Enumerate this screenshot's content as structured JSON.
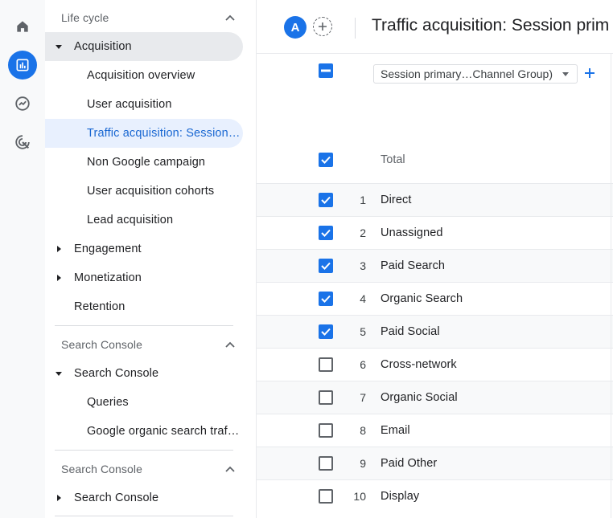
{
  "rail": {
    "items": [
      {
        "icon": "home-icon",
        "active": false
      },
      {
        "icon": "reports-icon",
        "active": true
      },
      {
        "icon": "explore-icon",
        "active": false
      },
      {
        "icon": "advertising-icon",
        "active": false
      }
    ]
  },
  "nav": {
    "sections": [
      {
        "title": "Life cycle",
        "items": [
          {
            "label": "Acquisition",
            "level": 1,
            "caret": "down",
            "expanded": true
          },
          {
            "label": "Acquisition overview",
            "level": 2
          },
          {
            "label": "User acquisition",
            "level": 2
          },
          {
            "label": "Traffic acquisition: Session…",
            "level": 2,
            "selected": true
          },
          {
            "label": "Non Google campaign",
            "level": 2
          },
          {
            "label": "User acquisition cohorts",
            "level": 2
          },
          {
            "label": "Lead acquisition",
            "level": 2
          },
          {
            "label": "Engagement",
            "level": 1,
            "caret": "right"
          },
          {
            "label": "Monetization",
            "level": 1,
            "caret": "right"
          },
          {
            "label": "Retention",
            "level": 1
          }
        ]
      },
      {
        "title": "Search Console",
        "items": [
          {
            "label": "Search Console",
            "level": 1,
            "caret": "down"
          },
          {
            "label": "Queries",
            "level": 2
          },
          {
            "label": "Google organic search traf…",
            "level": 2
          }
        ]
      },
      {
        "title": "Search Console",
        "items": [
          {
            "label": "Search Console",
            "level": 1,
            "caret": "right"
          }
        ]
      }
    ]
  },
  "header": {
    "avatar_letter": "A",
    "title": "Traffic acquisition: Session prim"
  },
  "table": {
    "dimension_select": "Session primary…Channel Group)",
    "total_label": "Total",
    "rows": [
      {
        "num": "1",
        "label": "Direct",
        "checked": true
      },
      {
        "num": "2",
        "label": "Unassigned",
        "checked": true
      },
      {
        "num": "3",
        "label": "Paid Search",
        "checked": true
      },
      {
        "num": "4",
        "label": "Organic Search",
        "checked": true
      },
      {
        "num": "5",
        "label": "Paid Social",
        "checked": true
      },
      {
        "num": "6",
        "label": "Cross-network",
        "checked": false
      },
      {
        "num": "7",
        "label": "Organic Social",
        "checked": false
      },
      {
        "num": "8",
        "label": "Email",
        "checked": false
      },
      {
        "num": "9",
        "label": "Paid Other",
        "checked": false
      },
      {
        "num": "10",
        "label": "Display",
        "checked": false
      }
    ]
  },
  "colors": {
    "accent": "#1a73e8",
    "selected_bg": "#e8f0fe",
    "selected_text": "#1967d2"
  }
}
